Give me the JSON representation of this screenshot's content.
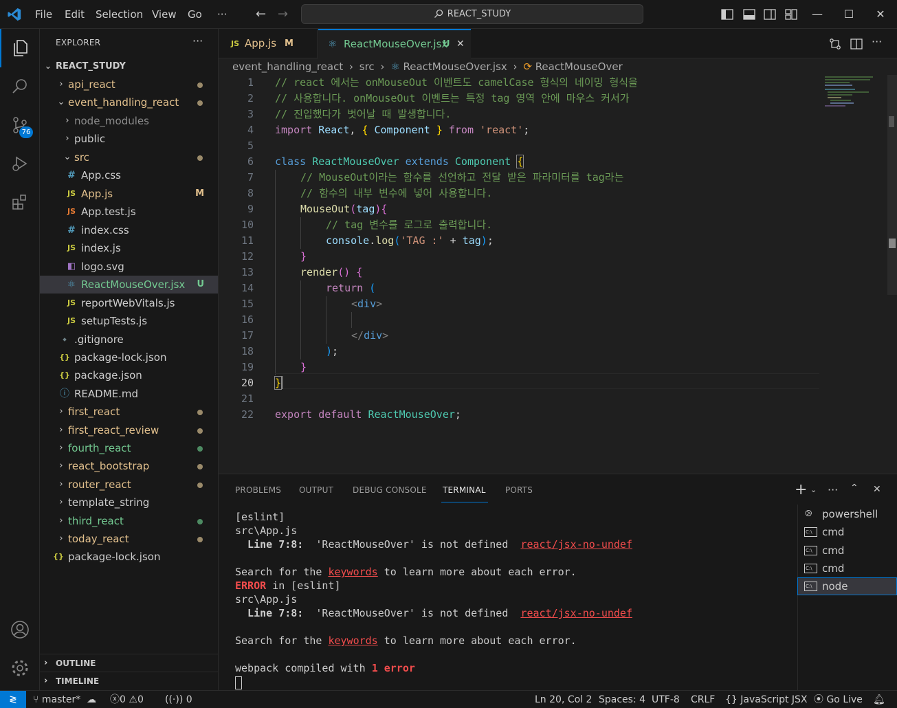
{
  "titlebar": {
    "menu": [
      "File",
      "Edit",
      "Selection",
      "View",
      "Go"
    ],
    "more": "···",
    "search": "REACT_STUDY"
  },
  "activity": {
    "scm_badge": "76"
  },
  "explorer": {
    "title": "EXPLORER",
    "dots": "···",
    "root": "REACT_STUDY",
    "items": [
      {
        "label": "api_react",
        "deco": ""
      },
      {
        "label": "event_handling_react",
        "deco": ""
      },
      {
        "label": "node_modules",
        "deco": ""
      },
      {
        "label": "public",
        "deco": ""
      },
      {
        "label": "src",
        "deco": ""
      },
      {
        "label": "App.css",
        "deco": ""
      },
      {
        "label": "App.js",
        "deco": "M"
      },
      {
        "label": "App.test.js",
        "deco": ""
      },
      {
        "label": "index.css",
        "deco": ""
      },
      {
        "label": "index.js",
        "deco": ""
      },
      {
        "label": "logo.svg",
        "deco": ""
      },
      {
        "label": "ReactMouseOver.jsx",
        "deco": "U"
      },
      {
        "label": "reportWebVitals.js",
        "deco": ""
      },
      {
        "label": "setupTests.js",
        "deco": ""
      },
      {
        "label": ".gitignore",
        "deco": ""
      },
      {
        "label": "package-lock.json",
        "deco": ""
      },
      {
        "label": "package.json",
        "deco": ""
      },
      {
        "label": "README.md",
        "deco": ""
      },
      {
        "label": "first_react",
        "deco": ""
      },
      {
        "label": "first_react_review",
        "deco": ""
      },
      {
        "label": "fourth_react",
        "deco": ""
      },
      {
        "label": "react_bootstrap",
        "deco": ""
      },
      {
        "label": "router_react",
        "deco": ""
      },
      {
        "label": "template_string",
        "deco": ""
      },
      {
        "label": "third_react",
        "deco": ""
      },
      {
        "label": "today_react",
        "deco": ""
      },
      {
        "label": "package-lock.json",
        "deco": ""
      }
    ],
    "outline": "OUTLINE",
    "timeline": "TIMELINE"
  },
  "tabs": [
    {
      "icon": "JS",
      "label": "App.js",
      "deco": "M"
    },
    {
      "icon": "⚛",
      "label": "ReactMouseOver.jsx",
      "deco": "U",
      "close": "✕"
    }
  ],
  "breadcrumb": [
    "event_handling_react",
    "src",
    "ReactMouseOver.jsx",
    "ReactMouseOver"
  ],
  "editor": {
    "line_numbers": [
      "1",
      "2",
      "3",
      "4",
      "5",
      "6",
      "7",
      "8",
      "9",
      "10",
      "11",
      "12",
      "13",
      "14",
      "15",
      "16",
      "17",
      "18",
      "19",
      "20",
      "21",
      "22"
    ],
    "lines": {
      "l1": "// react 에서는 onMouseOut 이벤트도 camelCase 형식의 네이밍 형식을",
      "l2": "// 사용합니다. onMouseOut 이벤트는 특정 tag 영역 안에 마우스 커서가",
      "l3": "// 진입했다가 벗어날 때 발생합니다.",
      "l4": [
        "import",
        "React",
        ", ",
        "{",
        " Component ",
        "}",
        " from ",
        "'react'",
        ";"
      ],
      "l6": [
        "class",
        "ReactMouseOver",
        "extends",
        "Component",
        "{"
      ],
      "l7": "// MouseOut이라는 함수를 선언하고 전달 받은 파라미터를 tag라는",
      "l8": "// 함수의 내부 변수에 넣어 사용합니다.",
      "l9": [
        "MouseOut",
        "(",
        "tag",
        ")",
        "{"
      ],
      "l10": "// tag 변수를 로그로 출력합니다.",
      "l11": [
        "console",
        ".",
        "log",
        "(",
        "'TAG :'",
        " + ",
        "tag",
        ")",
        ";"
      ],
      "l12": "}",
      "l13": [
        "render",
        "()",
        " {"
      ],
      "l14": [
        "return",
        " ("
      ],
      "l15": [
        "<",
        "div",
        ">"
      ],
      "l17": [
        "</",
        "div",
        ">"
      ],
      "l18": [
        ")",
        ";"
      ],
      "l19": "}",
      "l20": "}",
      "l22": [
        "export",
        "default",
        "ReactMouseOver",
        ";"
      ]
    }
  },
  "panel": {
    "tabs": [
      "PROBLEMS",
      "OUTPUT",
      "DEBUG CONSOLE",
      "TERMINAL",
      "PORTS"
    ],
    "active_tab": "TERMINAL",
    "terminal": {
      "t1": "[eslint]",
      "t2": "src\\App.js",
      "t3a": "  Line 7:8:",
      "t3b": "  'ReactMouseOver' is not defined  ",
      "t3c": "react/jsx-no-undef",
      "t5a": "Search for the ",
      "t5b": "keywords",
      "t5c": " to learn more about each error.",
      "t6a": "ERROR",
      "t6b": " in [eslint]",
      "t7": "src\\App.js",
      "t8a": "  Line 7:8:",
      "t8b": "  'ReactMouseOver' is not defined  ",
      "t8c": "react/jsx-no-undef",
      "t10a": "Search for the ",
      "t10b": "keywords",
      "t10c": " to learn more about each error.",
      "t12a": "webpack compiled with ",
      "t12b": "1 error"
    },
    "terminals": [
      "powershell",
      "cmd",
      "cmd",
      "cmd",
      "node"
    ]
  },
  "statusbar": {
    "branch": "master*",
    "errors": "0",
    "warnings": "0",
    "ports": "0",
    "position": "Ln 20, Col 2",
    "spaces": "Spaces: 4",
    "encoding": "UTF-8",
    "eol": "CRLF",
    "language": "JavaScript JSX",
    "golive": "Go Live"
  },
  "colors": {
    "accent": "#0078d4",
    "modified": "#e2c08d",
    "untracked": "#73c991",
    "error": "#f14c4c"
  }
}
